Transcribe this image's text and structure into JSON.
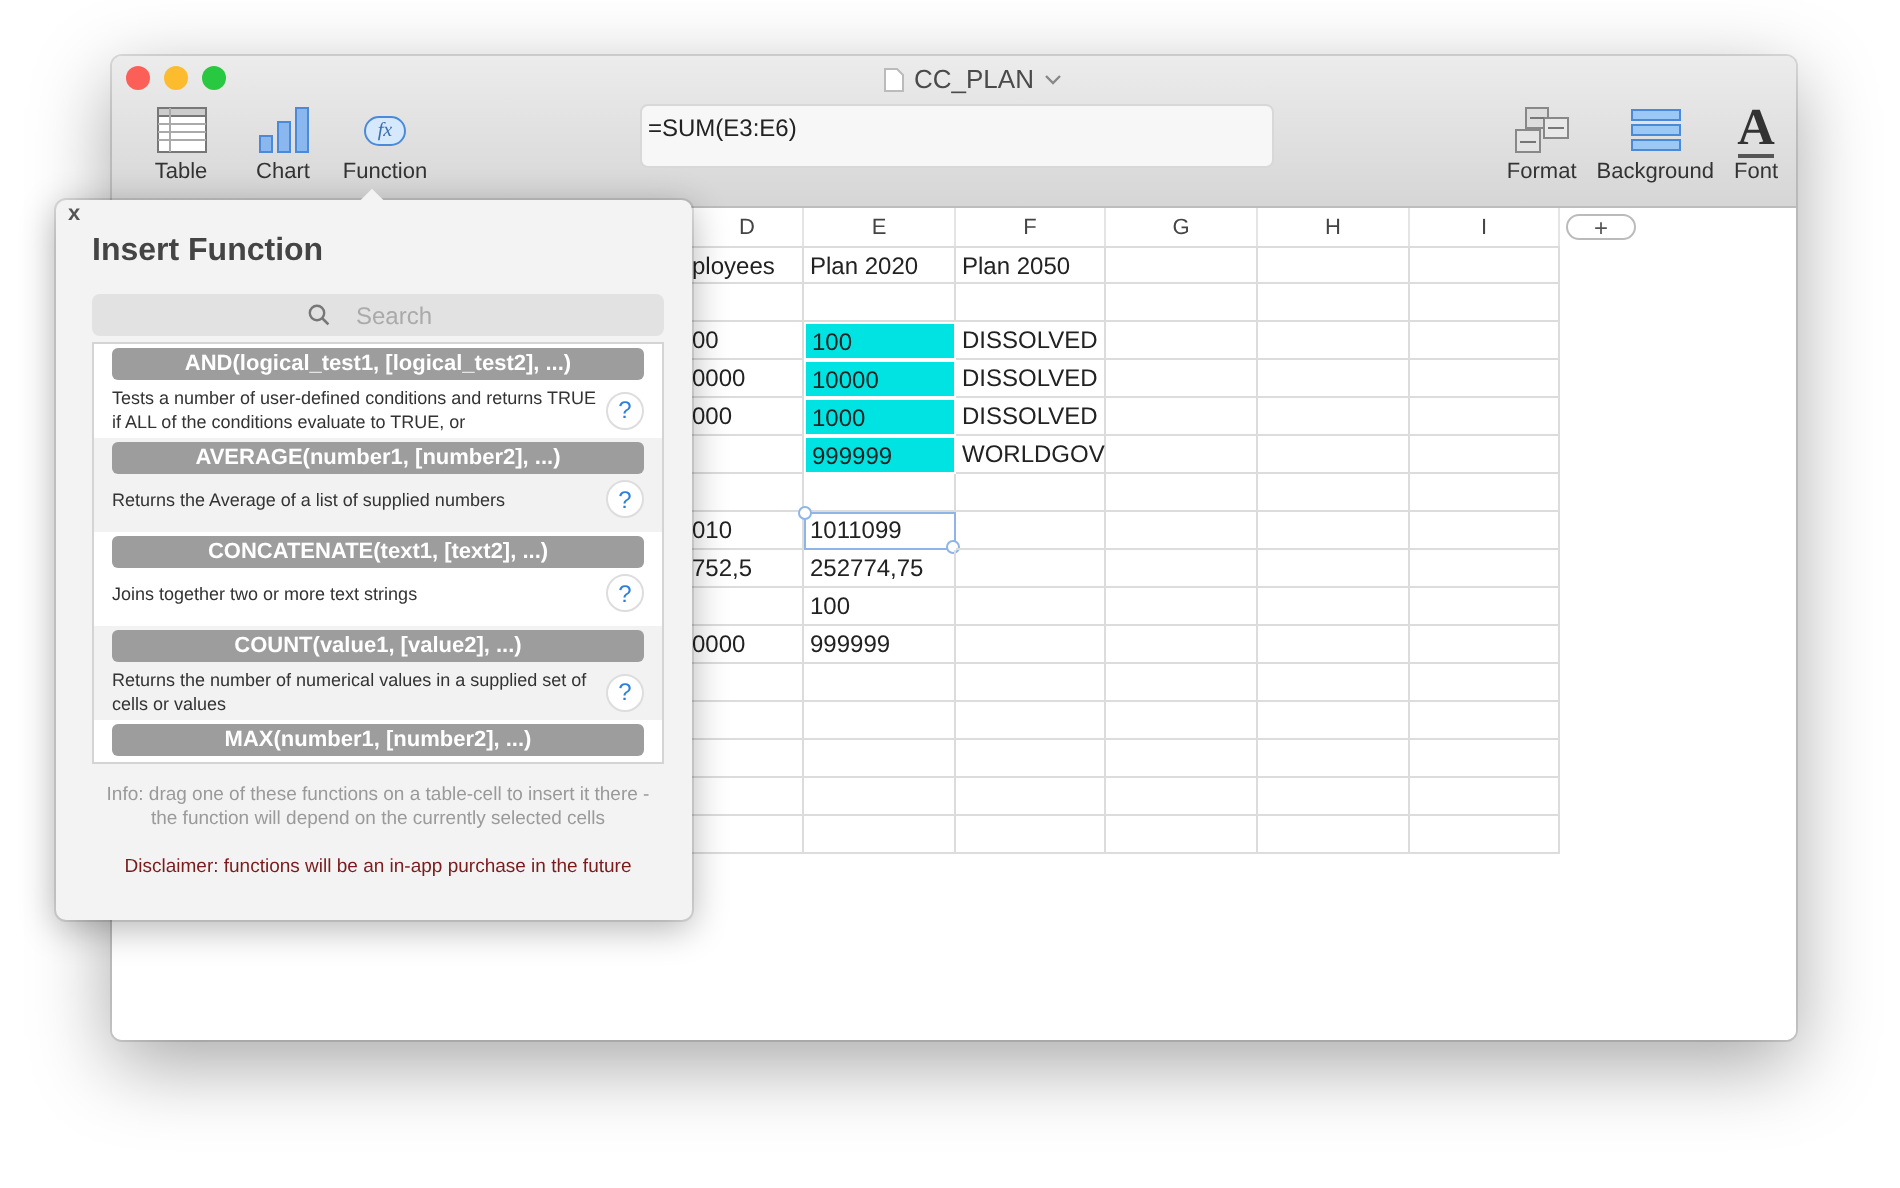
{
  "window": {
    "title": "CC_PLAN"
  },
  "toolbar_left": [
    {
      "kind": "table",
      "label": "Table"
    },
    {
      "kind": "chart",
      "label": "Chart"
    },
    {
      "kind": "function",
      "label": "Function",
      "glyph": "fx"
    }
  ],
  "formula": {
    "value": "=SUM(E3:E6)"
  },
  "toolbar_right": [
    {
      "kind": "format",
      "label": "Format"
    },
    {
      "kind": "background",
      "label": "Background"
    },
    {
      "kind": "font",
      "label": "Font",
      "glyph": "A"
    }
  ],
  "sheet": {
    "columns": [
      "D",
      "E",
      "F",
      "G",
      "H",
      "I"
    ],
    "add_column": "+",
    "rows": [
      [
        {
          "text": "ployees",
          "highlighted": false,
          "selected": false
        },
        {
          "text": "Plan 2020",
          "highlighted": false,
          "selected": false
        },
        {
          "text": "Plan 2050",
          "highlighted": false,
          "selected": false
        },
        {
          "highlighted": false,
          "selected": false
        },
        {
          "highlighted": false,
          "selected": false
        },
        {
          "highlighted": false,
          "selected": false
        }
      ],
      [
        {
          "highlighted": false,
          "selected": false
        },
        {
          "highlighted": false,
          "selected": false
        },
        {
          "highlighted": false,
          "selected": false
        },
        {
          "highlighted": false,
          "selected": false
        },
        {
          "highlighted": false,
          "selected": false
        },
        {
          "highlighted": false,
          "selected": false
        }
      ],
      [
        {
          "text": "00",
          "highlighted": false,
          "selected": false
        },
        {
          "text": "100",
          "highlighted": true,
          "selected": false
        },
        {
          "text": "DISSOLVED",
          "highlighted": false,
          "selected": false
        },
        {
          "highlighted": false,
          "selected": false
        },
        {
          "highlighted": false,
          "selected": false
        },
        {
          "highlighted": false,
          "selected": false
        }
      ],
      [
        {
          "text": "0000",
          "highlighted": false,
          "selected": false
        },
        {
          "text": "10000",
          "highlighted": true,
          "selected": false
        },
        {
          "text": "DISSOLVED",
          "highlighted": false,
          "selected": false
        },
        {
          "highlighted": false,
          "selected": false
        },
        {
          "highlighted": false,
          "selected": false
        },
        {
          "highlighted": false,
          "selected": false
        }
      ],
      [
        {
          "text": "000",
          "highlighted": false,
          "selected": false
        },
        {
          "text": "1000",
          "highlighted": true,
          "selected": false
        },
        {
          "text": "DISSOLVED",
          "highlighted": false,
          "selected": false
        },
        {
          "highlighted": false,
          "selected": false
        },
        {
          "highlighted": false,
          "selected": false
        },
        {
          "highlighted": false,
          "selected": false
        }
      ],
      [
        {
          "highlighted": false,
          "selected": false
        },
        {
          "text": "999999",
          "highlighted": true,
          "selected": false
        },
        {
          "text": "WORLDGOV",
          "highlighted": false,
          "selected": false
        },
        {
          "highlighted": false,
          "selected": false
        },
        {
          "highlighted": false,
          "selected": false
        },
        {
          "highlighted": false,
          "selected": false
        }
      ],
      [
        {
          "highlighted": false,
          "selected": false
        },
        {
          "highlighted": false,
          "selected": false
        },
        {
          "highlighted": false,
          "selected": false
        },
        {
          "highlighted": false,
          "selected": false
        },
        {
          "highlighted": false,
          "selected": false
        },
        {
          "highlighted": false,
          "selected": false
        }
      ],
      [
        {
          "text": "010",
          "highlighted": false,
          "selected": false
        },
        {
          "text": "1011099",
          "highlighted": false,
          "selected": true
        },
        {
          "highlighted": false,
          "selected": false
        },
        {
          "highlighted": false,
          "selected": false
        },
        {
          "highlighted": false,
          "selected": false
        },
        {
          "highlighted": false,
          "selected": false
        }
      ],
      [
        {
          "text": "752,5",
          "highlighted": false,
          "selected": false
        },
        {
          "text": "252774,75",
          "highlighted": false,
          "selected": false
        },
        {
          "highlighted": false,
          "selected": false
        },
        {
          "highlighted": false,
          "selected": false
        },
        {
          "highlighted": false,
          "selected": false
        },
        {
          "highlighted": false,
          "selected": false
        }
      ],
      [
        {
          "highlighted": false,
          "selected": false
        },
        {
          "text": "100",
          "highlighted": false,
          "selected": false
        },
        {
          "highlighted": false,
          "selected": false
        },
        {
          "highlighted": false,
          "selected": false
        },
        {
          "highlighted": false,
          "selected": false
        },
        {
          "highlighted": false,
          "selected": false
        }
      ],
      [
        {
          "text": "0000",
          "highlighted": false,
          "selected": false
        },
        {
          "text": "999999",
          "highlighted": false,
          "selected": false
        },
        {
          "highlighted": false,
          "selected": false
        },
        {
          "highlighted": false,
          "selected": false
        },
        {
          "highlighted": false,
          "selected": false
        },
        {
          "highlighted": false,
          "selected": false
        }
      ],
      [
        {
          "highlighted": false,
          "selected": false
        },
        {
          "highlighted": false,
          "selected": false
        },
        {
          "highlighted": false,
          "selected": false
        },
        {
          "highlighted": false,
          "selected": false
        },
        {
          "highlighted": false,
          "selected": false
        },
        {
          "highlighted": false,
          "selected": false
        }
      ],
      [
        {
          "highlighted": false,
          "selected": false
        },
        {
          "highlighted": false,
          "selected": false
        },
        {
          "highlighted": false,
          "selected": false
        },
        {
          "highlighted": false,
          "selected": false
        },
        {
          "highlighted": false,
          "selected": false
        },
        {
          "highlighted": false,
          "selected": false
        }
      ],
      [
        {
          "highlighted": false,
          "selected": false
        },
        {
          "highlighted": false,
          "selected": false
        },
        {
          "highlighted": false,
          "selected": false
        },
        {
          "highlighted": false,
          "selected": false
        },
        {
          "highlighted": false,
          "selected": false
        },
        {
          "highlighted": false,
          "selected": false
        }
      ],
      [
        {
          "highlighted": false,
          "selected": false
        },
        {
          "highlighted": false,
          "selected": false
        },
        {
          "highlighted": false,
          "selected": false
        },
        {
          "highlighted": false,
          "selected": false
        },
        {
          "highlighted": false,
          "selected": false
        },
        {
          "highlighted": false,
          "selected": false
        }
      ],
      [
        {
          "highlighted": false,
          "selected": false
        },
        {
          "highlighted": false,
          "selected": false
        },
        {
          "highlighted": false,
          "selected": false
        },
        {
          "highlighted": false,
          "selected": false
        },
        {
          "highlighted": false,
          "selected": false
        },
        {
          "highlighted": false,
          "selected": false
        }
      ]
    ]
  },
  "insert_function": {
    "close": "x",
    "title": "Insert Function",
    "search": {
      "placeholder": "Search"
    },
    "functions": [
      {
        "signature": "AND(logical_test1, [logical_test2], ...)",
        "description": "Tests a number of user-defined conditions and returns TRUE if ALL of the conditions evaluate to TRUE, or",
        "help": "?"
      },
      {
        "signature": "AVERAGE(number1, [number2], ...)",
        "description": "Returns the Average of a list of supplied numbers",
        "help": "?"
      },
      {
        "signature": "CONCATENATE(text1, [text2], ...)",
        "description": "Joins together two or more text strings",
        "help": "?"
      },
      {
        "signature": "COUNT(value1, [value2], ...)",
        "description": "Returns the number of numerical values in a supplied set of cells or values",
        "help": "?"
      },
      {
        "signature": "MAX(number1, [number2], ...)"
      }
    ],
    "info": "Info: drag one of these functions on a table-cell to insert it there - the function will depend on the currently selected cells",
    "disclaimer": "Disclaimer: functions will be an in-app purchase in the future"
  }
}
